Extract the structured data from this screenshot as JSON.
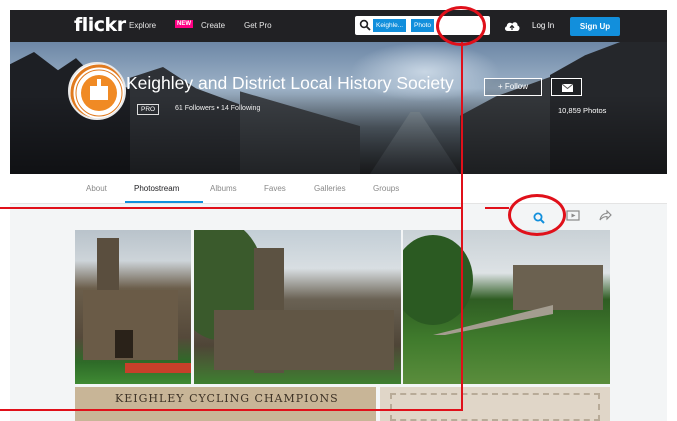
{
  "topnav": {
    "logo": "flickr",
    "explore": "Explore",
    "new_badge": "NEW",
    "create": "Create",
    "get_pro": "Get Pro",
    "search_chip_1": "Keighle...",
    "search_chip_2": "Photo",
    "login": "Log In",
    "signup": "Sign Up"
  },
  "profile": {
    "name": "Keighley and District Local History Society",
    "pro_badge": "PRO",
    "followers": "61 Followers",
    "separator": "•",
    "following": "14 Following",
    "follow_button": "+ Follow",
    "photo_count": "10,859 Photos"
  },
  "subnav": {
    "tabs": [
      {
        "label": "About"
      },
      {
        "label": "Photostream",
        "active": true
      },
      {
        "label": "Albums"
      },
      {
        "label": "Faves"
      },
      {
        "label": "Galleries"
      },
      {
        "label": "Groups"
      }
    ]
  },
  "photos": {
    "banner_text": "KEIGHLEY CYCLING CHAMPIONS"
  },
  "toolbar": {
    "icons": [
      "search-icon",
      "slideshow-icon",
      "share-icon"
    ]
  },
  "colors": {
    "accent": "#128fdc",
    "nav_bg": "#212124",
    "new_badge": "#ff0084",
    "annotation": "#e0101a"
  }
}
